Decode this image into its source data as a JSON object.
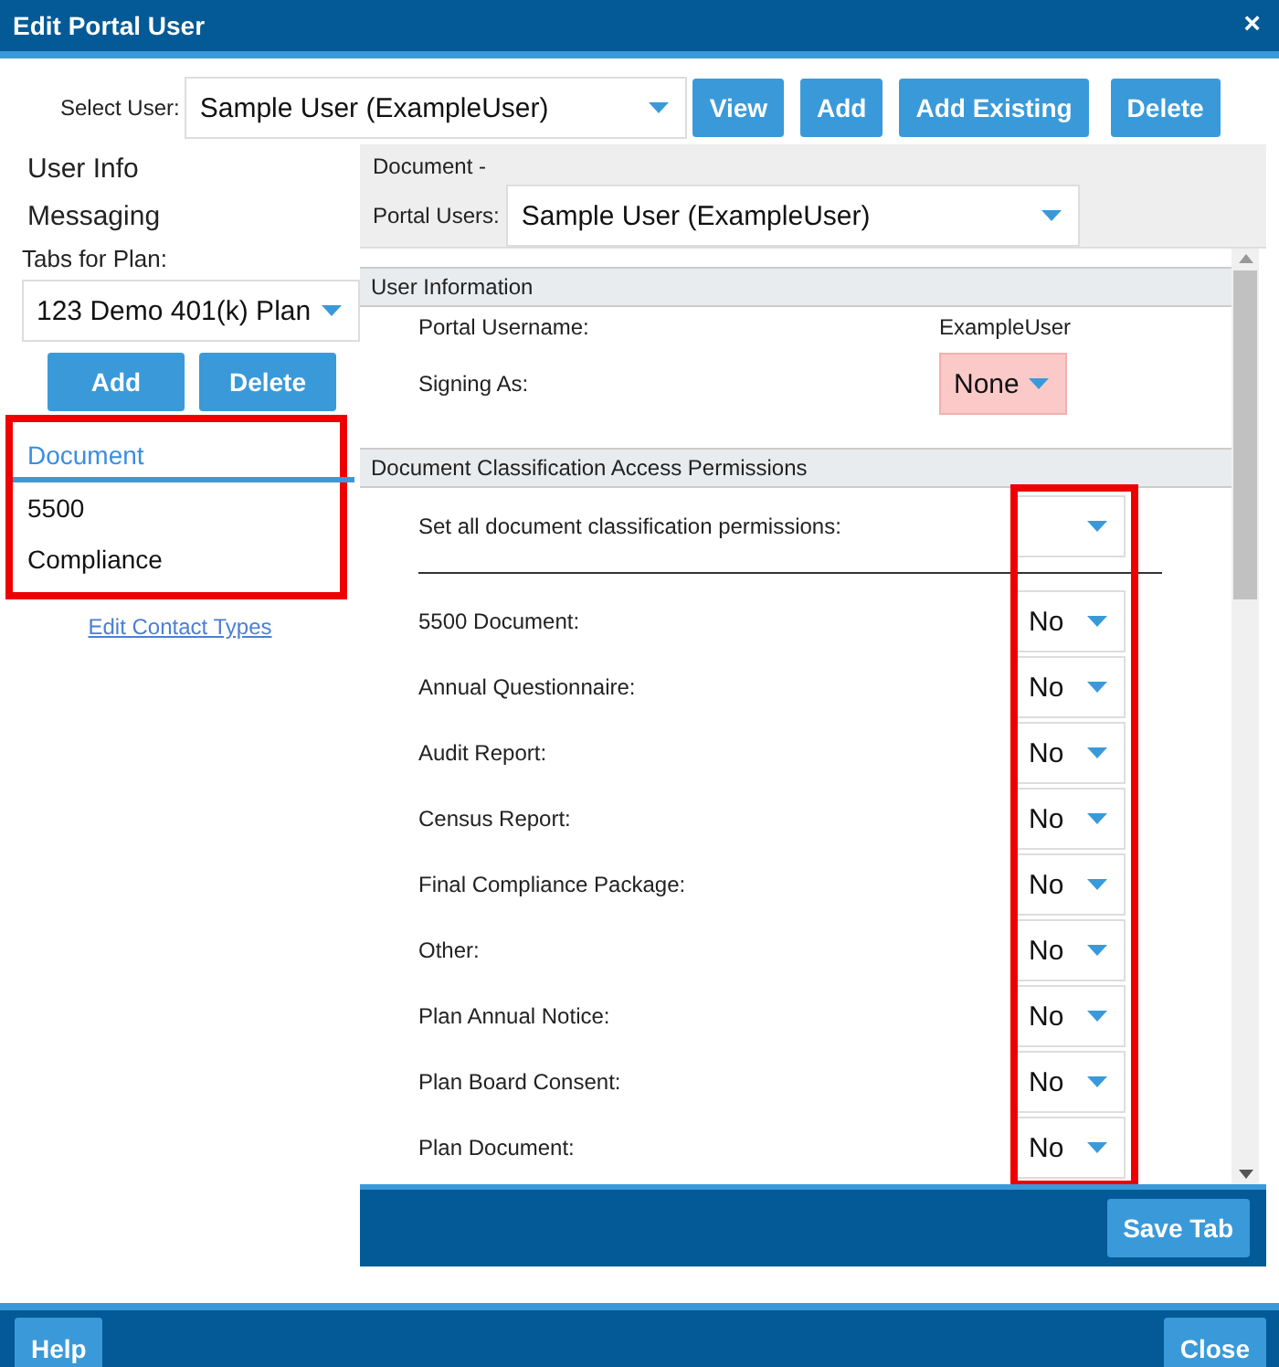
{
  "window": {
    "title": "Edit Portal User",
    "close": "×"
  },
  "user_select": {
    "label": "Select User:",
    "value": "Sample User (ExampleUser)"
  },
  "top_buttons": [
    "View",
    "Add",
    "Add Existing",
    "Delete"
  ],
  "nav": [
    "User Info",
    "Messaging"
  ],
  "plan_tabs": {
    "label": "Tabs for Plan:",
    "plan": "123 Demo 401(k) Plan",
    "buttons": [
      "Add",
      "Delete"
    ],
    "highlighted": true,
    "items": [
      {
        "label": "Document",
        "selected": true
      },
      {
        "label": "5500",
        "selected": false
      },
      {
        "label": "Compliance",
        "selected": false
      }
    ],
    "link": "Edit Contact Types"
  },
  "panel": {
    "heading": "Document -",
    "portal_users_label": "Portal Users:",
    "portal_users_value": "Sample User (ExampleUser)",
    "user_info": {
      "title": "User Information",
      "username_label": "Portal Username:",
      "username": "ExampleUser",
      "signing_label": "Signing As:",
      "signing_value": "None",
      "signing_invalid": true
    },
    "permissions": {
      "title": "Document Classification Access Permissions",
      "set_all_label": "Set all document classification permissions:",
      "highlighted": true,
      "items": [
        {
          "label": "5500 Document:",
          "value": "No"
        },
        {
          "label": "Annual Questionnaire:",
          "value": "No"
        },
        {
          "label": "Audit Report:",
          "value": "No"
        },
        {
          "label": "Census Report:",
          "value": "No"
        },
        {
          "label": "Final Compliance Package:",
          "value": "No"
        },
        {
          "label": "Other:",
          "value": "No"
        },
        {
          "label": "Plan Annual Notice:",
          "value": "No"
        },
        {
          "label": "Plan Board Consent:",
          "value": "No"
        },
        {
          "label": "Plan Document:",
          "value": "No"
        }
      ]
    },
    "save_button": "Save Tab"
  },
  "footer": {
    "buttons": [
      "Help",
      "Close"
    ]
  }
}
